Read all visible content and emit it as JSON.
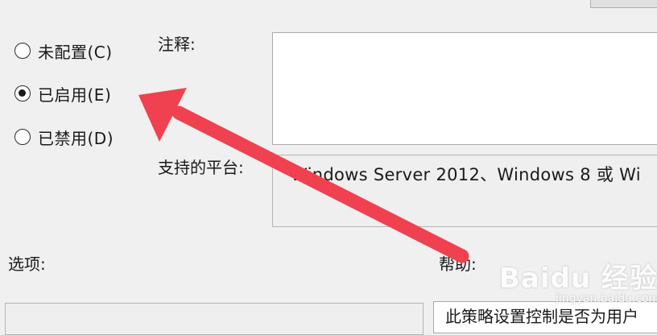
{
  "radios": [
    {
      "label": "未配置(C)",
      "checked": false
    },
    {
      "label": "已启用(E)",
      "checked": true
    },
    {
      "label": "已禁用(D)",
      "checked": false
    }
  ],
  "labels": {
    "comment": "注释:",
    "supported_platforms": "支持的平台:",
    "options": "选项:",
    "help": "帮助:"
  },
  "platform_text": "Windows Server 2012、Windows 8 或 Wi",
  "help_text": "此策略设置控制是否为用户",
  "watermark": {
    "main": "Baidu 经验",
    "sub": "jingyan.baidu.com"
  },
  "colors": {
    "arrow": "#f04150",
    "panel": "#f0f0f0"
  }
}
